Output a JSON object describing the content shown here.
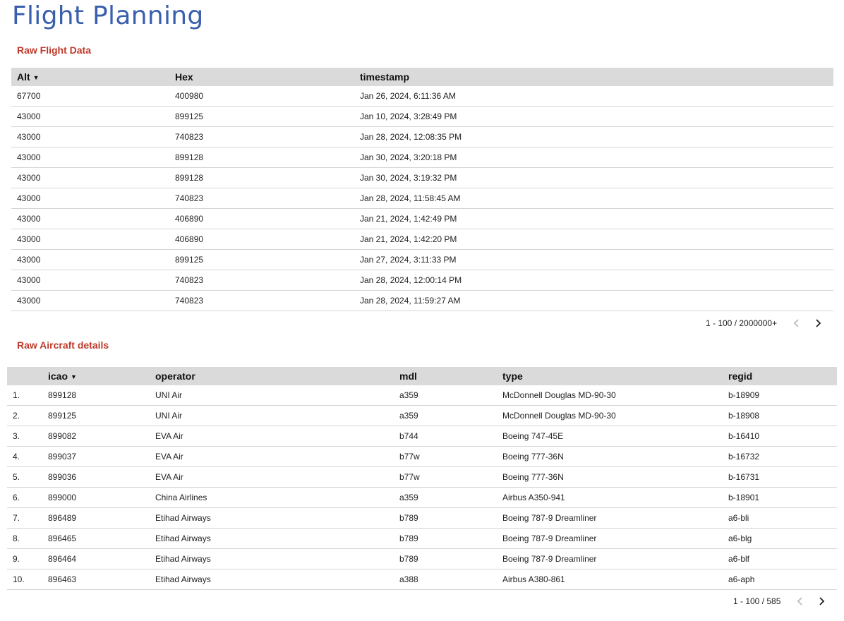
{
  "page": {
    "title": "Flight Planning"
  },
  "flight_table": {
    "title": "Raw Flight Data",
    "columns": [
      "Alt",
      "Hex",
      "timestamp"
    ],
    "rows": [
      [
        "67700",
        "400980",
        "Jan 26, 2024, 6:11:36 AM"
      ],
      [
        "43000",
        "899125",
        "Jan 10, 2024, 3:28:49 PM"
      ],
      [
        "43000",
        "740823",
        "Jan 28, 2024, 12:08:35 PM"
      ],
      [
        "43000",
        "899128",
        "Jan 30, 2024, 3:20:18 PM"
      ],
      [
        "43000",
        "899128",
        "Jan 30, 2024, 3:19:32 PM"
      ],
      [
        "43000",
        "740823",
        "Jan 28, 2024, 11:58:45 AM"
      ],
      [
        "43000",
        "406890",
        "Jan 21, 2024, 1:42:49 PM"
      ],
      [
        "43000",
        "406890",
        "Jan 21, 2024, 1:42:20 PM"
      ],
      [
        "43000",
        "899125",
        "Jan 27, 2024, 3:11:33 PM"
      ],
      [
        "43000",
        "740823",
        "Jan 28, 2024, 12:00:14 PM"
      ],
      [
        "43000",
        "740823",
        "Jan 28, 2024, 11:59:27 AM"
      ]
    ],
    "pagination": "1 - 100 / 2000000+"
  },
  "aircraft_table": {
    "title": "Raw Aircraft details",
    "columns": [
      "",
      "icao",
      "operator",
      "mdl",
      "type",
      "regid"
    ],
    "rows": [
      [
        "1.",
        "899128",
        "UNI Air",
        "a359",
        "McDonnell Douglas MD-90-30",
        "b-18909"
      ],
      [
        "2.",
        "899125",
        "UNI Air",
        "a359",
        "McDonnell Douglas MD-90-30",
        "b-18908"
      ],
      [
        "3.",
        "899082",
        "EVA Air",
        "b744",
        "Boeing 747-45E",
        "b-16410"
      ],
      [
        "4.",
        "899037",
        "EVA Air",
        "b77w",
        "Boeing 777-36N",
        "b-16732"
      ],
      [
        "5.",
        "899036",
        "EVA Air",
        "b77w",
        "Boeing 777-36N",
        "b-16731"
      ],
      [
        "6.",
        "899000",
        "China Airlines",
        "a359",
        "Airbus A350-941",
        "b-18901"
      ],
      [
        "7.",
        "896489",
        "Etihad Airways",
        "b789",
        "Boeing 787-9 Dreamliner",
        "a6-bli"
      ],
      [
        "8.",
        "896465",
        "Etihad Airways",
        "b789",
        "Boeing 787-9 Dreamliner",
        "a6-blg"
      ],
      [
        "9.",
        "896464",
        "Etihad Airways",
        "b789",
        "Boeing 787-9 Dreamliner",
        "a6-blf"
      ],
      [
        "10.",
        "896463",
        "Etihad Airways",
        "a388",
        "Airbus A380-861",
        "a6-aph"
      ]
    ],
    "pagination": "1 - 100 / 585"
  },
  "icons": {
    "sort": "sort-desc-icon",
    "prev": "chevron-left-icon",
    "next": "chevron-right-icon"
  },
  "colors": {
    "title": "#3a5fae",
    "section_title": "#c0392b",
    "header_bg": "#dadada",
    "pager_disabled": "#bbbbbb"
  }
}
